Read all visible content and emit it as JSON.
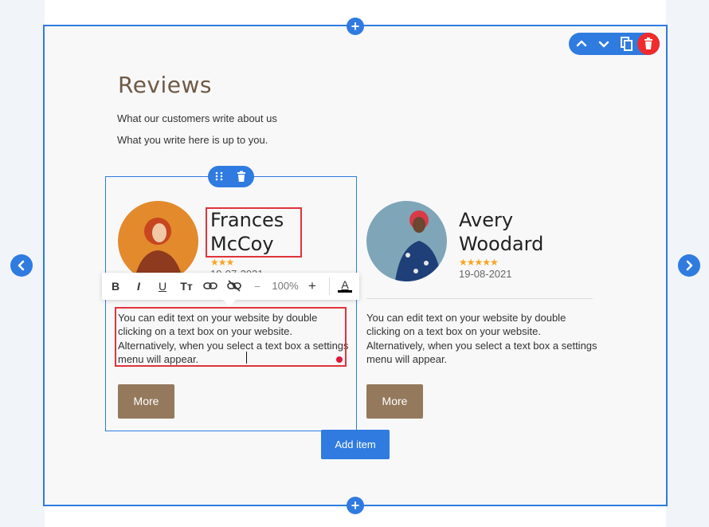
{
  "section": {
    "title": "Reviews",
    "subtitle": "What our customers write about us",
    "description": "What you write here is up to you."
  },
  "controls": {
    "add_block_symbol": "+",
    "prev_symbol": "‹",
    "next_symbol": "›",
    "add_item_label": "Add item",
    "accent_color": "#2f7be0",
    "delete_color": "#ef2b2b"
  },
  "section_toolbar": [
    "chevron-up-icon",
    "chevron-down-icon",
    "copy-icon",
    "trash-icon"
  ],
  "text_toolbar": {
    "bold": "B",
    "italic": "I",
    "underline": "U",
    "text_size": "Tт",
    "zoom_minus": "−",
    "zoom_value": "100%",
    "zoom_plus": "+",
    "text_color": "A"
  },
  "reviews": [
    {
      "name_line1": "Frances",
      "name_line2": "McCoy",
      "stars": "★★★",
      "rating": 3,
      "date": "19-07-2021",
      "text": "You can edit text on your website by double clicking on a text box on your website. Alternatively, when you select a text box a settings menu will appear.",
      "more_label": "More"
    },
    {
      "name_line1": "Avery",
      "name_line2": "Woodard",
      "stars": "★★★★★",
      "rating": 5,
      "date": "19-08-2021",
      "text": "You can edit text on your website by double clicking on a text box on your website. Alternatively, when you select a text box a settings menu will appear.",
      "more_label": "More"
    }
  ]
}
